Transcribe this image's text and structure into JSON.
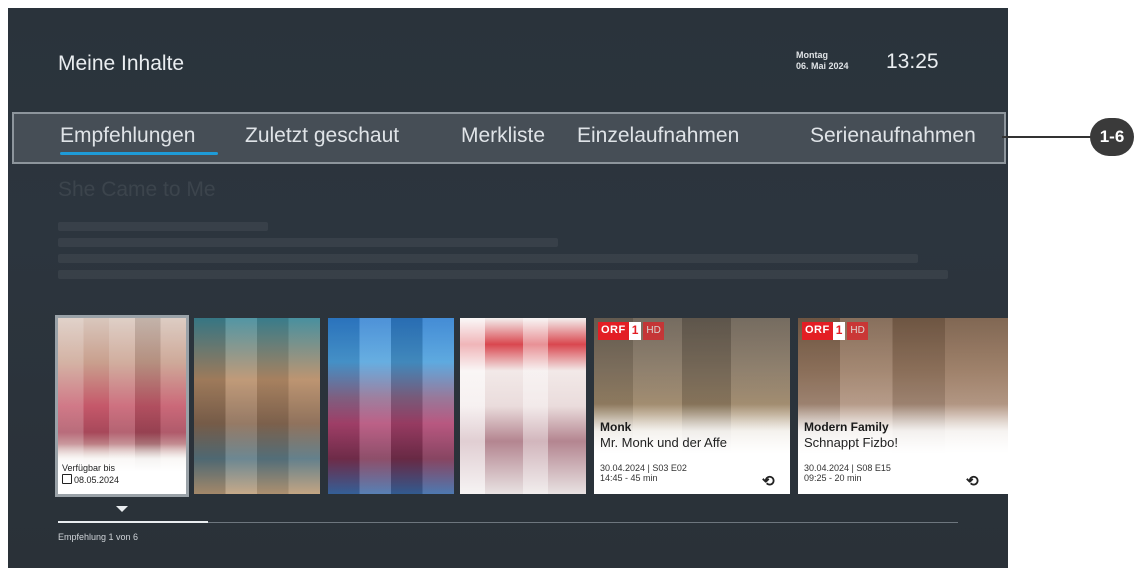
{
  "header": {
    "title": "Meine Inhalte",
    "day": "Montag",
    "date": "06. Mai 2024",
    "time": "13:25"
  },
  "tabs": [
    {
      "label": "Empfehlungen",
      "active": true
    },
    {
      "label": "Zuletzt geschaut"
    },
    {
      "label": "Merkliste"
    },
    {
      "label": "Einzelaufnahmen"
    },
    {
      "label": "Serienaufnahmen"
    }
  ],
  "detail": {
    "title": "She Came to Me"
  },
  "tiles": [
    {
      "available_label": "Verfügbar bis",
      "available_date": "08.05.2024"
    },
    {},
    {},
    {},
    {
      "channel": "ORF",
      "channel_num": "1",
      "quality": "HD",
      "series": "Monk",
      "episode": "Mr. Monk und der Affe",
      "meta_line1": "30.04.2024 | S03 E02",
      "meta_line2": "14:45 - 45 min",
      "icon": "replay-icon"
    },
    {
      "channel": "ORF",
      "channel_num": "1",
      "quality": "HD",
      "series": "Modern Family",
      "episode": "Schnappt Fizbo!",
      "meta_line1": "30.04.2024 | S08 E15",
      "meta_line2": "09:25 - 20 min",
      "icon": "replay-icon"
    }
  ],
  "pager": {
    "label": "Empfehlung 1 von 6",
    "progress": 0.167
  },
  "callout": {
    "label": "1-6"
  },
  "colors": {
    "accent": "#1e9bd8",
    "background": "#2b343c",
    "orf_red": "#e31e24"
  }
}
